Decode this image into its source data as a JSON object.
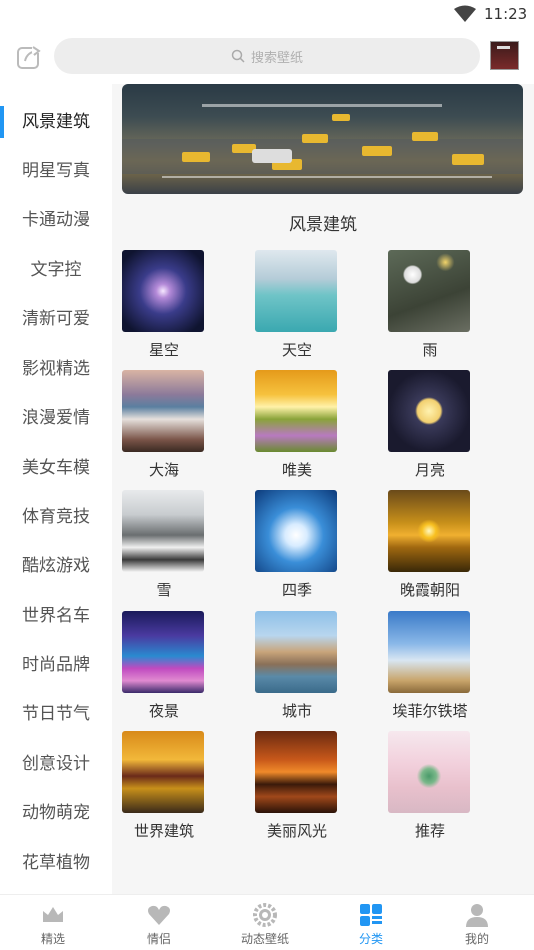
{
  "status": {
    "time": "11:23"
  },
  "search": {
    "placeholder": "搜索壁纸"
  },
  "sidebar": {
    "items": [
      {
        "label": "风景建筑",
        "active": true
      },
      {
        "label": "明星写真"
      },
      {
        "label": "卡通动漫"
      },
      {
        "label": "文字控"
      },
      {
        "label": "清新可爱"
      },
      {
        "label": "影视精选"
      },
      {
        "label": "浪漫爱情"
      },
      {
        "label": "美女车模"
      },
      {
        "label": "体育竞技"
      },
      {
        "label": "酷炫游戏"
      },
      {
        "label": "世界名车"
      },
      {
        "label": "时尚品牌"
      },
      {
        "label": "节日节气"
      },
      {
        "label": "创意设计"
      },
      {
        "label": "动物萌宠"
      },
      {
        "label": "花草植物"
      }
    ]
  },
  "main": {
    "section_title": "风景建筑",
    "tiles": [
      {
        "label": "星空"
      },
      {
        "label": "天空"
      },
      {
        "label": "雨"
      },
      {
        "label": "大海"
      },
      {
        "label": "唯美"
      },
      {
        "label": "月亮"
      },
      {
        "label": "雪"
      },
      {
        "label": "四季"
      },
      {
        "label": "晚霞朝阳"
      },
      {
        "label": "夜景"
      },
      {
        "label": "城市"
      },
      {
        "label": "埃菲尔铁塔"
      },
      {
        "label": "世界建筑"
      },
      {
        "label": "美丽风光"
      },
      {
        "label": "推荐"
      }
    ]
  },
  "tabbar": {
    "items": [
      {
        "label": "精选",
        "icon": "crown-icon"
      },
      {
        "label": "情侣",
        "icon": "heart-icon"
      },
      {
        "label": "动态壁纸",
        "icon": "gear-icon"
      },
      {
        "label": "分类",
        "icon": "category-grid-icon",
        "active": true
      },
      {
        "label": "我的",
        "icon": "user-icon"
      }
    ]
  },
  "colors": {
    "accent": "#2196f3",
    "sidebar_text": "#555555",
    "content_bg": "#f6f6f6"
  }
}
